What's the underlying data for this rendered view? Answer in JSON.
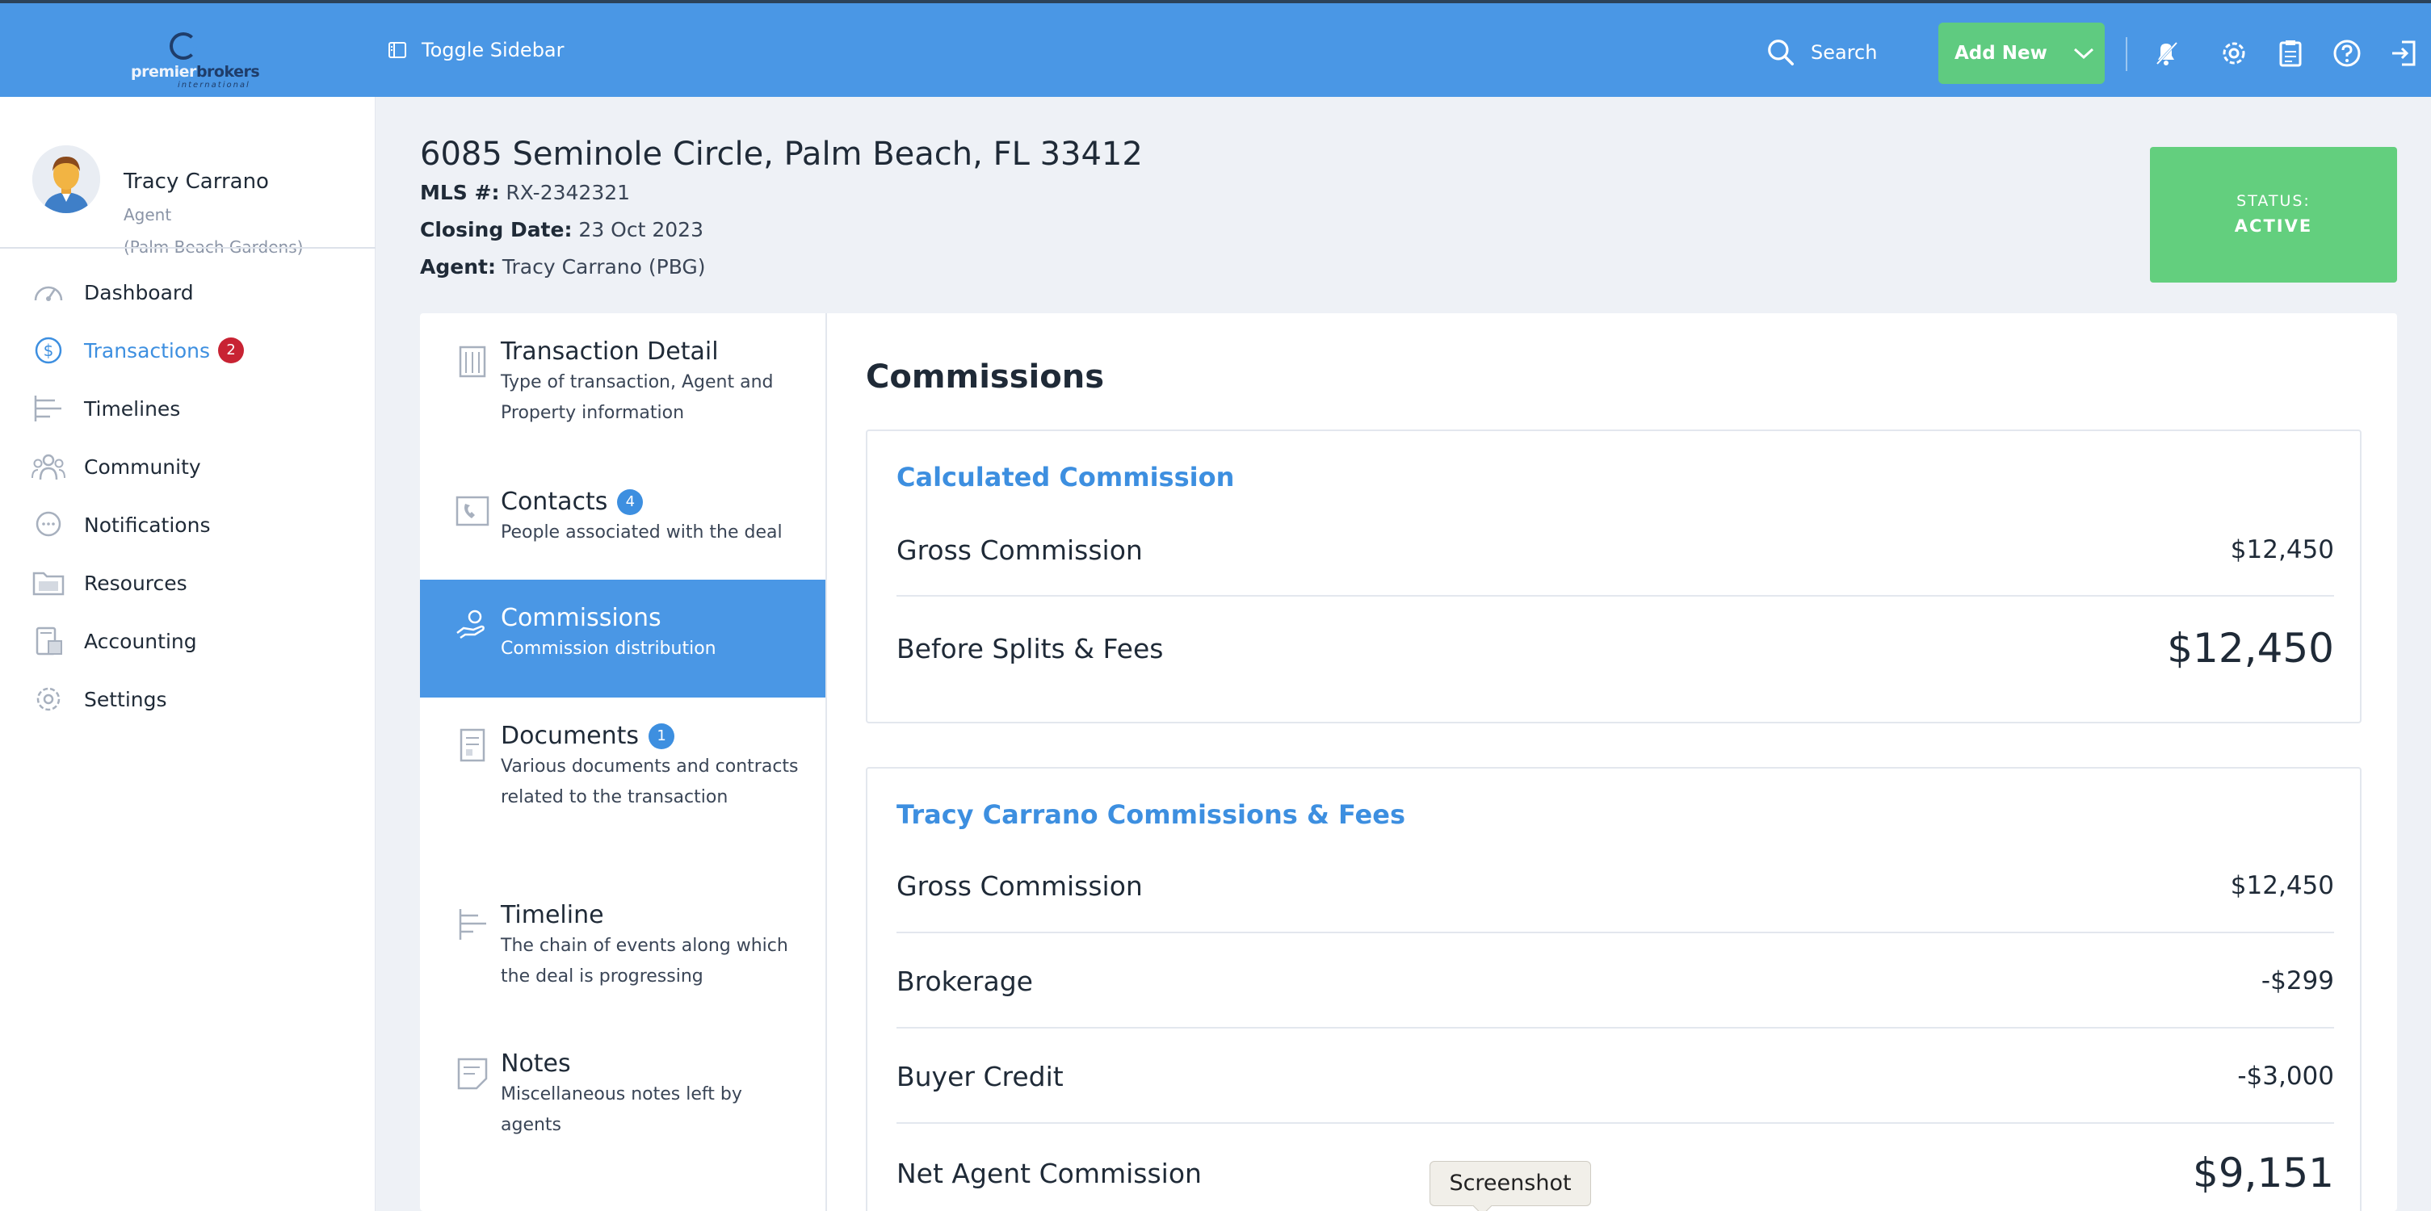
{
  "brand": {
    "logo_text_a": "premier",
    "logo_text_b": "brokers",
    "logo_sub": "international"
  },
  "topbar": {
    "toggle_label": "Toggle Sidebar",
    "search_label": "Search",
    "add_new_label": "Add New",
    "icons": [
      "bell-slash-icon",
      "gear-icon",
      "clipboard-icon",
      "help-icon",
      "logout-icon"
    ]
  },
  "profile": {
    "name": "Tracy Carrano",
    "role": "Agent",
    "branch": "(Palm Beach Gardens)"
  },
  "sidebar": {
    "items": [
      {
        "label": "Dashboard",
        "icon": "speedometer-icon"
      },
      {
        "label": "Transactions",
        "icon": "dollar-circle-icon",
        "badge": "2",
        "active": true
      },
      {
        "label": "Timelines",
        "icon": "timeline-icon"
      },
      {
        "label": "Community",
        "icon": "people-icon"
      },
      {
        "label": "Notifications",
        "icon": "chat-bubble-icon"
      },
      {
        "label": "Resources",
        "icon": "folder-icon"
      },
      {
        "label": "Accounting",
        "icon": "calculator-icon"
      },
      {
        "label": "Settings",
        "icon": "gear-icon"
      }
    ]
  },
  "property": {
    "address": "6085 Seminole Circle, Palm Beach, FL 33412",
    "mls_label": "MLS #:",
    "mls_value": "RX-2342321",
    "closing_label": "Closing Date:",
    "closing_value": "23 Oct 2023",
    "agent_label": "Agent:",
    "agent_value": "Tracy Carrano (PBG)",
    "status_label": "STATUS:",
    "status_value": "ACTIVE"
  },
  "subnav": [
    {
      "title": "Transaction Detail",
      "desc": "Type of transaction, Agent and Property information"
    },
    {
      "title": "Contacts",
      "badge": "4",
      "desc": "People associated with the deal"
    },
    {
      "title": "Commissions",
      "desc": "Commission distribution",
      "active": true
    },
    {
      "title": "Documents",
      "badge": "1",
      "desc": "Various documents and contracts related to the transaction"
    },
    {
      "title": "Timeline",
      "desc": "The chain of events along which the deal is progressing"
    },
    {
      "title": "Notes",
      "desc": "Miscellaneous notes left by agents"
    }
  ],
  "commissions": {
    "title": "Commissions",
    "calculated": {
      "heading": "Calculated Commission",
      "rows": [
        {
          "label": "Gross Commission",
          "value": "$12,450"
        },
        {
          "label": "Before Splits & Fees",
          "value": "$12,450"
        }
      ]
    },
    "agent": {
      "heading": "Tracy Carrano Commissions & Fees",
      "rows": [
        {
          "label": "Gross Commission",
          "value": "$12,450"
        },
        {
          "label": "Brokerage",
          "value": "-$299"
        },
        {
          "label": "Buyer Credit",
          "value": "-$3,000"
        },
        {
          "label": "Net Agent Commission",
          "value": "$9,151"
        }
      ]
    }
  },
  "tooltip": "Screenshot",
  "colors": {
    "primary": "#4a97e5",
    "success": "#63cf7e",
    "danger": "#c82333"
  }
}
